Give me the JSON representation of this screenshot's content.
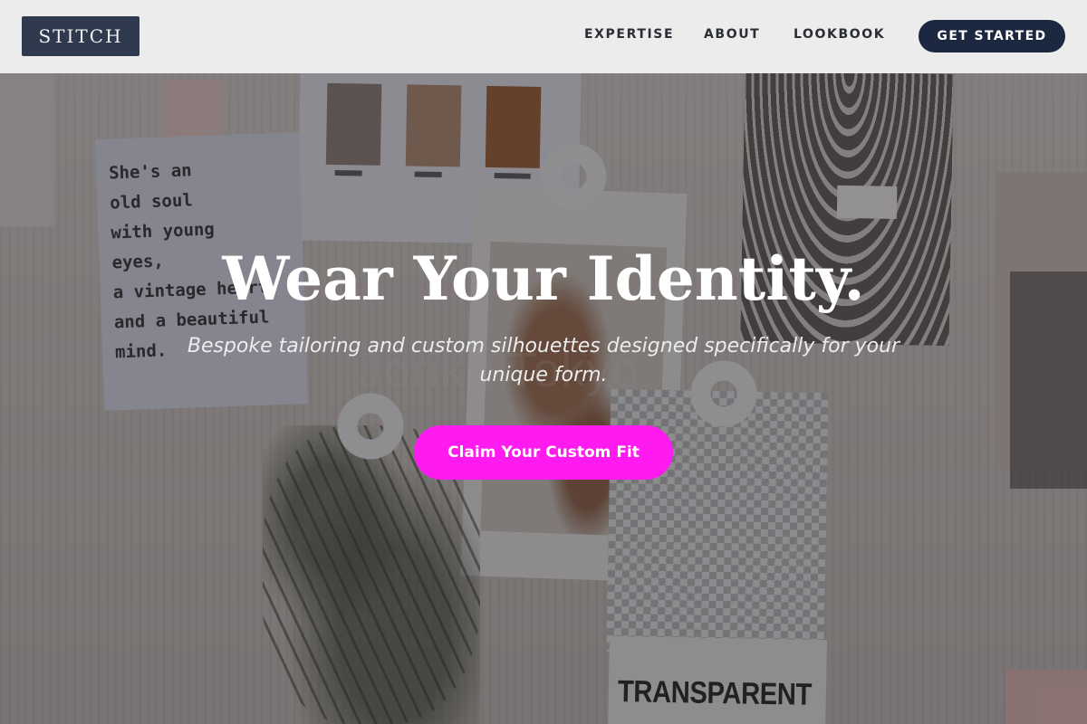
{
  "brand": {
    "logo_text": "STITCH"
  },
  "nav": {
    "links": [
      "EXPERTISE",
      "ABOUT",
      "LOOKBOOK"
    ],
    "cta_label": "GET STARTED"
  },
  "hero": {
    "title": "Wear Your Identity.",
    "subtitle": "Bespoke tailoring and custom silhouettes designed specifically for your unique form.",
    "cta_label": "Claim Your Custom Fit"
  },
  "background": {
    "quote_note": "She's an\nold soul\nwith young\neyes,\na vintage heart,\nand a beautiful\nmind.",
    "poster_label": "TRANSPARENT",
    "watermark": "Joriku Tokyo"
  },
  "colors": {
    "nav_bg": "#f0f0f0",
    "logo_bg": "#2f3a4f",
    "cta_nav_bg": "#1c2740",
    "hero_cta_bg": "#ff1aef",
    "hero_text": "#ffffff"
  }
}
